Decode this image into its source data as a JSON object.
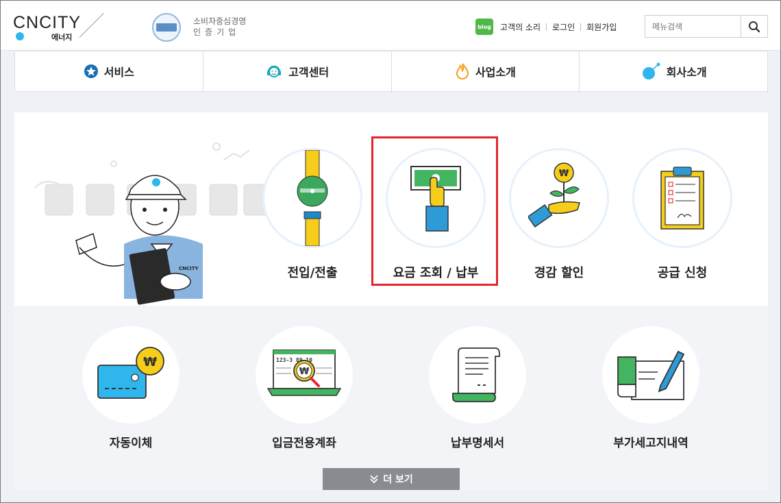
{
  "header": {
    "logo_text": "CNCITY",
    "logo_sub": "에너지",
    "cert_line1": "소비자중심경영",
    "cert_line2": "인증기업",
    "blog_label": "blog",
    "links": [
      "고객의 소리",
      "로그인",
      "회원가입"
    ],
    "search_placeholder": "메뉴검색"
  },
  "nav": {
    "items": [
      {
        "label": "서비스",
        "icon": "star-icon"
      },
      {
        "label": "고객센터",
        "icon": "headset-icon"
      },
      {
        "label": "사업소개",
        "icon": "flame-icon"
      },
      {
        "label": "회사소개",
        "icon": "dot-icon"
      }
    ]
  },
  "services_top": [
    {
      "label": "전입/전출",
      "icon": "gas-meter-icon"
    },
    {
      "label": "요금 조회 / 납부",
      "icon": "payment-icon"
    },
    {
      "label": "경감 할인",
      "icon": "discount-plant-icon"
    },
    {
      "label": "공급 신청",
      "icon": "clipboard-icon"
    }
  ],
  "services_bottom": [
    {
      "label": "자동이체",
      "icon": "card-icon"
    },
    {
      "label": "입금전용계좌",
      "icon": "account-search-icon"
    },
    {
      "label": "납부명세서",
      "icon": "receipt-icon"
    },
    {
      "label": "부가세고지내역",
      "icon": "tax-notice-icon"
    }
  ],
  "more_label": "더 보기",
  "mascot_badge": "CNCITY",
  "account_number": "123-3 89-10",
  "colors": {
    "accent": "#2fb6ec",
    "highlight": "#e52429",
    "blog": "#4fb848"
  }
}
